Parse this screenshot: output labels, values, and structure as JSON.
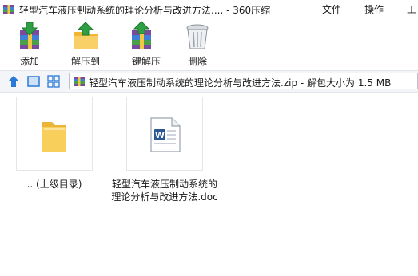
{
  "window": {
    "title": "轻型汽车液压制动系统的理论分析与改进方法.... - 360压缩",
    "menu": [
      "文件",
      "操作",
      "工"
    ]
  },
  "toolbar": {
    "buttons": [
      {
        "label": "添加",
        "icon": "add-archive-icon"
      },
      {
        "label": "解压到",
        "icon": "extract-to-icon"
      },
      {
        "label": "一键解压",
        "icon": "one-click-extract-icon"
      },
      {
        "label": "删除",
        "icon": "trash-icon"
      }
    ]
  },
  "address": {
    "path": "轻型汽车液压制动系统的理论分析与改进方法.zip - 解包大小为 1.5 MB"
  },
  "files": [
    {
      "name": ".. (上级目录)",
      "icon": "folder-icon"
    },
    {
      "name_line1": "轻型汽车液压制动系统的",
      "name_line2": "理论分析与改进方法.doc",
      "icon": "word-doc-icon"
    }
  ],
  "colors": {
    "accent": "#2b79d6",
    "folder": "#f6c94b",
    "word": "#2b5797"
  }
}
